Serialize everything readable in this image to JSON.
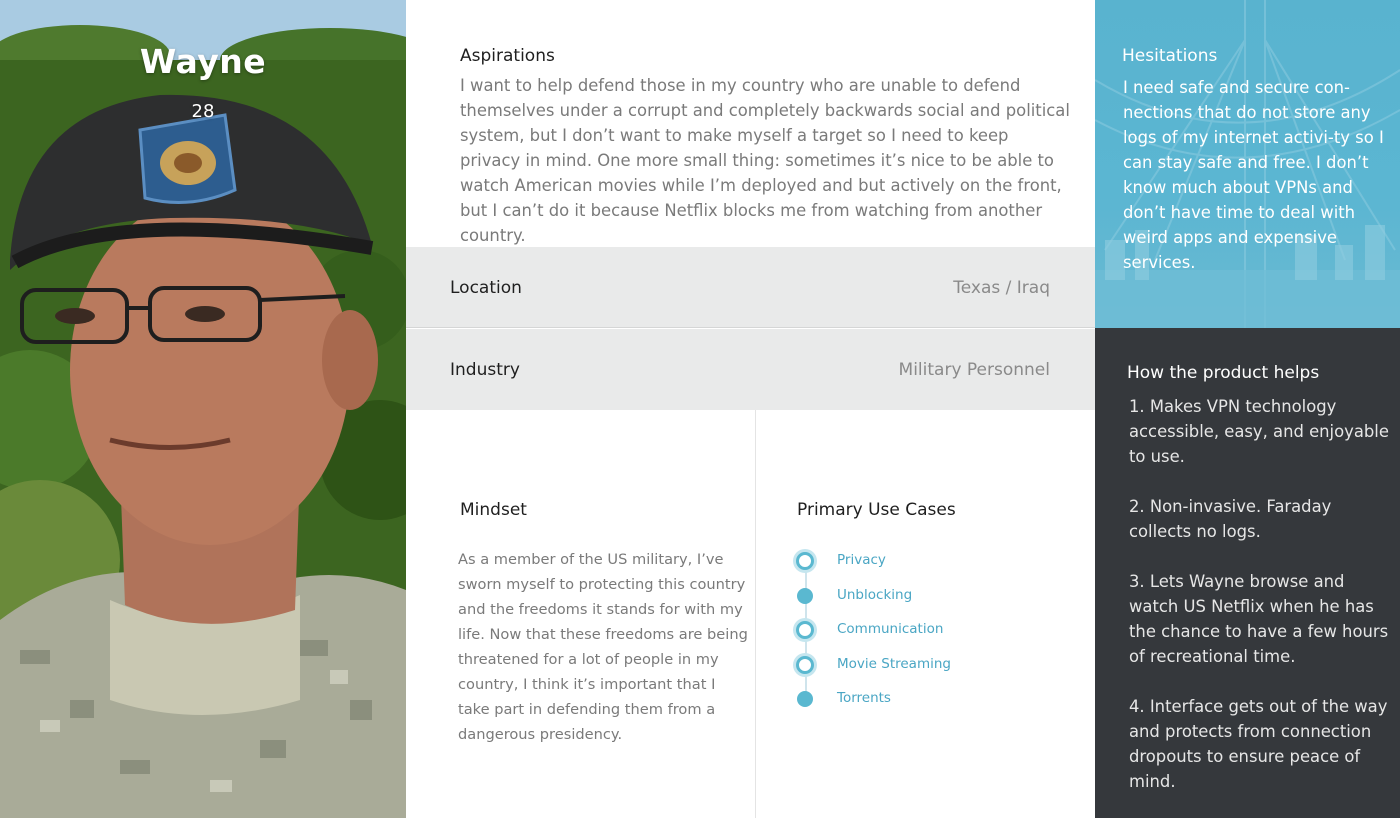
{
  "persona": {
    "name": "Wayne",
    "age": "28"
  },
  "aspirations": {
    "title": "Aspirations",
    "text": "I want to help defend those in my country who are unable to defend themselves under a corrupt and completely backwards social and political system, but I don’t want to make myself a target so I need to keep privacy in mind. One more small thing: sometimes it’s nice to be able to watch American movies while I’m deployed and but actively on the front, but I can’t do it because Netflix blocks me from watching from another country."
  },
  "location": {
    "label": "Location",
    "value": "Texas / Iraq"
  },
  "industry": {
    "label": "Industry",
    "value": "Military Personnel"
  },
  "mindset": {
    "title": "Mindset",
    "text": "As a member of the US military, I’ve sworn myself to protecting this country and the freedoms it stands for with my life. Now that these freedoms are being threatened for a lot of people in my country, I think it’s important that I take part in defending them from a dangerous presidency."
  },
  "use_cases": {
    "title": "Primary Use Cases",
    "items": [
      {
        "label": "Privacy",
        "marker": "ring"
      },
      {
        "label": "Unblocking",
        "marker": "fill"
      },
      {
        "label": "Communication",
        "marker": "ring"
      },
      {
        "label": "Movie Streaming",
        "marker": "ring"
      },
      {
        "label": "Torrents",
        "marker": "fill"
      }
    ]
  },
  "hesitations": {
    "title": "Hesitations",
    "text": "I need safe and secure con-nections that do not store any logs of my internet activi-ty so I can stay safe and free. I don’t know much about VPNs and don’t have time to deal with weird apps and expensive services."
  },
  "helps": {
    "title": "How the product helps",
    "items": [
      "1. Makes VPN technology accessible, easy, and enjoyable to use.",
      "2. Non-invasive. Faraday collects no logs.",
      "3. Lets Wayne browse and watch US Netflix when he has the chance to have a few hours of recreational time.",
      "4. Interface gets out of the way and protects from connection dropouts to ensure peace of mind."
    ]
  },
  "colors": {
    "accent": "#5ab8d0",
    "dark_panel": "#35383c",
    "row_bg": "#e9eaea"
  }
}
